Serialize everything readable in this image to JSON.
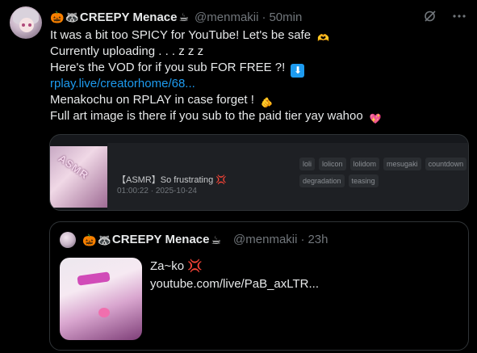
{
  "tweet": {
    "display_name": "CREEPY Menace",
    "name_emojis_before": [
      "🎃",
      "🦝"
    ],
    "name_emoji_after": "☕",
    "handle": "@menmakii",
    "time": "50min",
    "lines": [
      "It was a bit too SPICY for YouTube! Let's be safe",
      "Currently uploading . . . z z z",
      "Here's the VOD for if you sub FOR FREE ?!",
      "rplay.live/creatorhome/68...",
      "Menakochu on RPLAY in case forget !",
      "Full art image is there if you sub to the paid tier yay wahoo"
    ],
    "line_emojis": [
      "🫶",
      "",
      "⬇",
      "",
      "🫵",
      "💖"
    ]
  },
  "link_card": {
    "thumb_text": "ASMR",
    "title": "【ASMR】So frustrating 💢",
    "meta": "01:00:22 · 2025-10-24",
    "tags": [
      "loli",
      "lolicon",
      "lolidom",
      "mesugaki",
      "countdown",
      "degradation",
      "teasing"
    ]
  },
  "quote": {
    "display_name": "CREEPY Menace",
    "handle": "@menmakii",
    "time": "23h",
    "text_line1": "Za~ko 💢",
    "text_line2": "youtube.com/live/PaB_axLTR..."
  },
  "colors": {
    "background": "#000000",
    "text": "#e7e9ea",
    "muted": "#71767b",
    "link": "#1d9bf0",
    "border": "#2f3336"
  },
  "icons": [
    "grok-icon",
    "more-icon"
  ]
}
